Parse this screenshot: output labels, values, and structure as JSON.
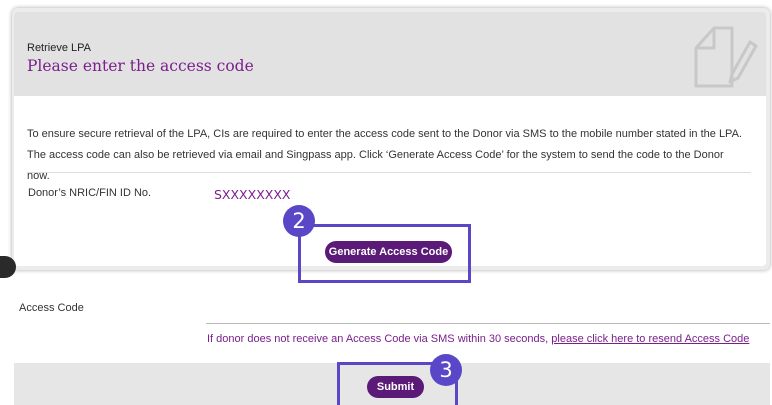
{
  "header": {
    "breadcrumb": "Retrieve LPA",
    "title": "Please enter the access code"
  },
  "body": {
    "description": "To ensure secure retrieval of the LPA, CIs are required to enter the access code sent to the Donor via SMS to the mobile number stated in the LPA. The access code can also be retrieved via email and Singpass app. Click ‘Generate Access Code’ for the system to send the code to the Donor now.",
    "nric_label": "Donor’s NRIC/FIN ID No.",
    "nric_value": "SXXXXXXXX"
  },
  "buttons": {
    "generate_label": "Generate Access Code",
    "submit_label": "Submit"
  },
  "annotations": {
    "step_2": "2",
    "step_3": "3",
    "highlight_color": "#5a47c8"
  },
  "access_code": {
    "label": "Access Code",
    "value": "",
    "resend_text": "If donor does not receive an Access Code via SMS within 30 seconds,",
    "resend_link": "please click here to resend Access Code"
  },
  "colors": {
    "brand": "#7a1f8c",
    "button": "#5b1a78",
    "header_bg": "#e2e2e3"
  },
  "icons": {
    "header_icon": "document-pen-icon"
  }
}
